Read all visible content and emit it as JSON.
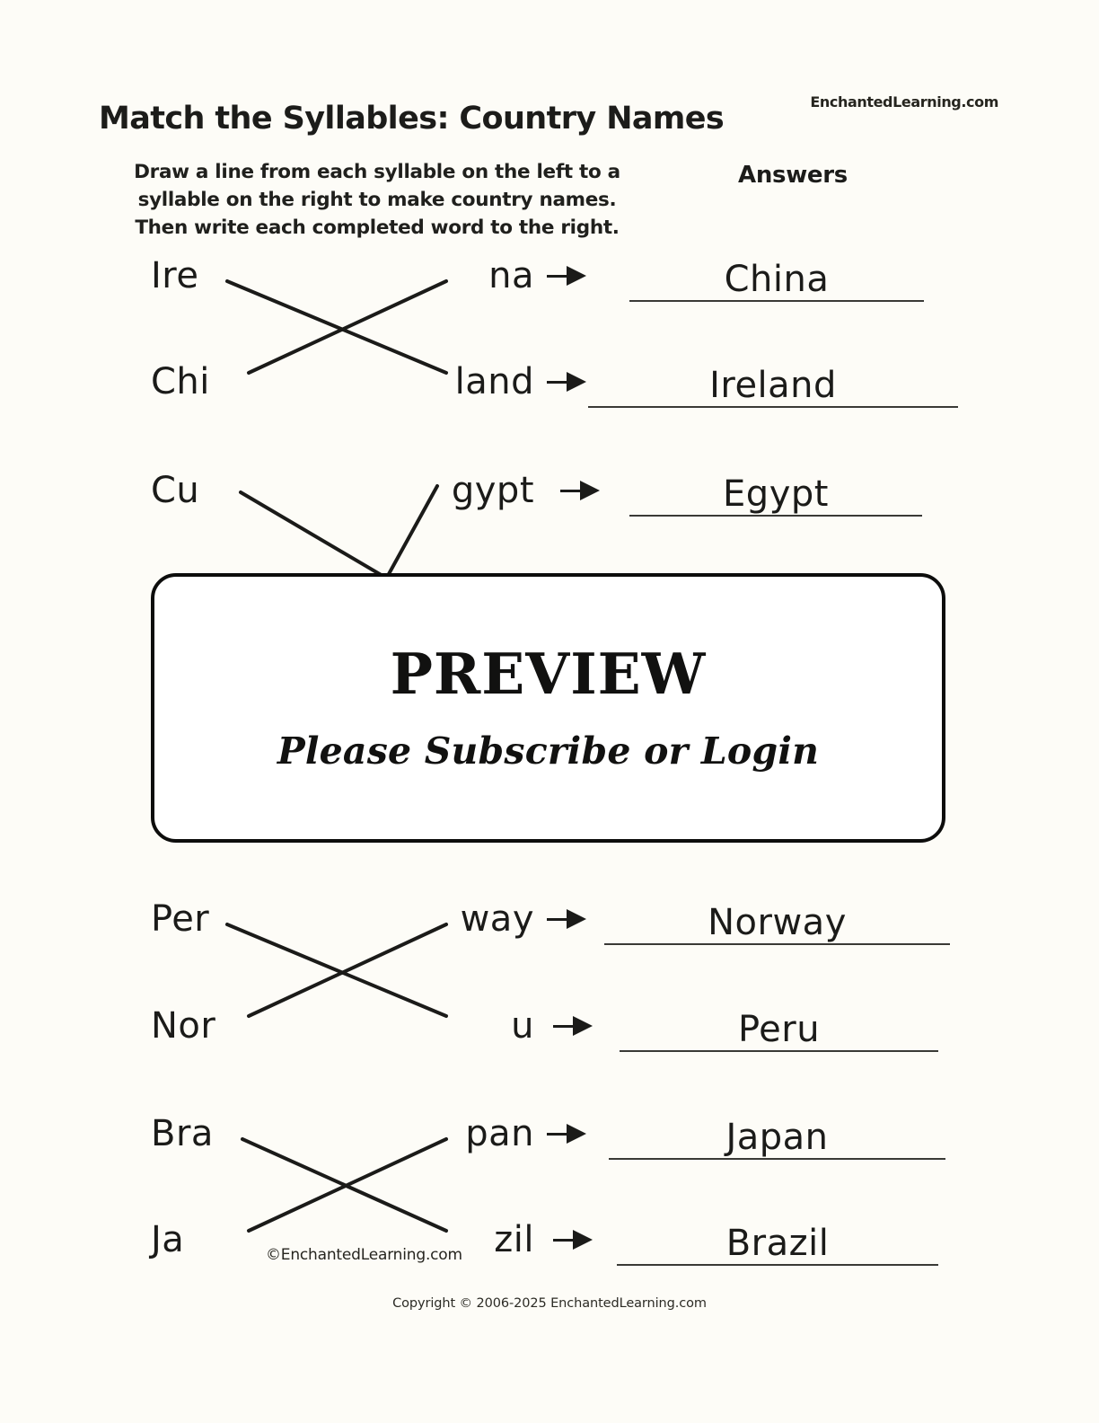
{
  "header": {
    "brand": "EnchantedLearning.com",
    "title": "Match the Syllables: Country Names",
    "instructions": [
      "Draw a line from each syllable on the left to a",
      "syllable on the right to make country names.",
      "Then write each completed word to the right."
    ],
    "answers_label": "Answers"
  },
  "rows": [
    {
      "left": "Ire",
      "right": "na",
      "answer": "China"
    },
    {
      "left": "Chi",
      "right": "land",
      "answer": "Ireland"
    },
    {
      "left": "Cu",
      "right": "gypt",
      "answer": "Egypt"
    },
    {
      "left": "Per",
      "right": "way",
      "answer": "Norway"
    },
    {
      "left": "Nor",
      "right": "u",
      "answer": "Peru"
    },
    {
      "left": "Bra",
      "right": "pan",
      "answer": "Japan"
    },
    {
      "left": "Ja",
      "right": "zil",
      "answer": "Brazil"
    }
  ],
  "overlay": {
    "title": "PREVIEW",
    "subtitle": "Please Subscribe or Login"
  },
  "footer": {
    "inline_credit": "©EnchantedLearning.com",
    "copyright": "Copyright © 2006-2025 EnchantedLearning.com"
  },
  "colors": {
    "page_background": "#fdfcf7",
    "ink": "#1b1b19",
    "overlay_background": "#ffffff",
    "overlay_border": "#0d0d0c"
  }
}
